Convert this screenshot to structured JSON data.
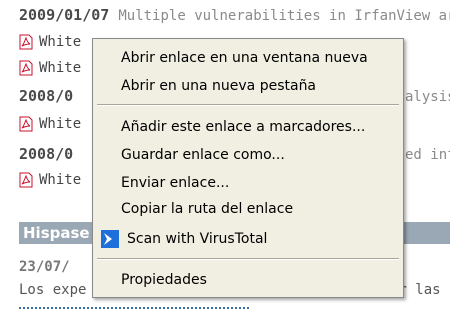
{
  "background": {
    "entries": [
      {
        "date": "2009/01/07",
        "text": "Multiple vulnerabilities in IrfanView ar"
      },
      {
        "date": "2008/0",
        "right": "alysis"
      },
      {
        "date": "2008/0",
        "right": "ed inf"
      }
    ],
    "doc_rows": [
      "White",
      "White",
      "White",
      "White",
      "White"
    ],
    "doc_first_suffix": "White",
    "section_title": "Hispase",
    "small_date": "23/07/",
    "bottom_text": "Los expe",
    "bottom_right": "ar las"
  },
  "context_menu": {
    "items": [
      {
        "id": "open-new-window",
        "label": "Abrir enlace en una ventana nueva",
        "icon": null
      },
      {
        "id": "open-new-tab",
        "label": "Abrir en una nueva pestaña",
        "icon": null
      },
      {
        "id": "add-bookmark",
        "label": "Añadir este enlace a marcadores...",
        "icon": null
      },
      {
        "id": "save-link-as",
        "label": "Guardar enlace como...",
        "icon": null
      },
      {
        "id": "send-link",
        "label": "Enviar enlace...",
        "icon": null
      },
      {
        "id": "copy-link-location",
        "label": "Copiar la ruta del enlace",
        "icon": null
      },
      {
        "id": "scan-virustotal",
        "label": "Scan with VirusTotal",
        "icon": "virustotal-icon"
      },
      {
        "id": "properties",
        "label": "Propiedades",
        "icon": null
      }
    ]
  },
  "colors": {
    "menu_bg": "#f1efe2",
    "section_bar": "#9aa7b4",
    "pdf_red": "#c8102e",
    "virustotal_blue": "#1e6fd9"
  }
}
